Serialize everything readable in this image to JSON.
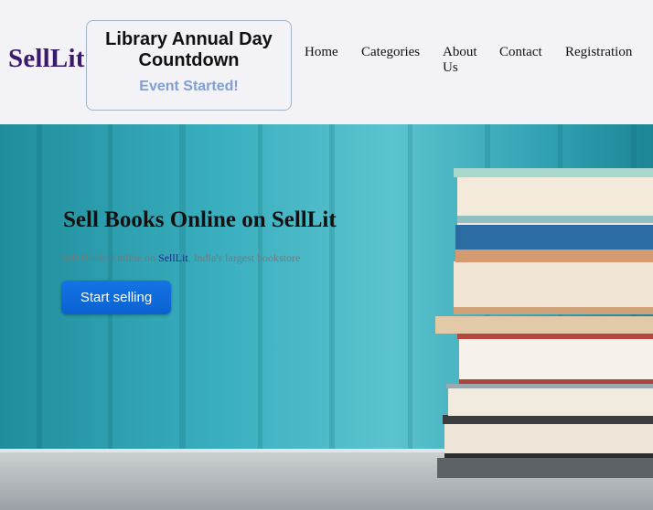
{
  "brand": {
    "logo_text": "SellLit"
  },
  "countdown": {
    "title": "Library Annual Day Countdown",
    "status": "Event Started!"
  },
  "nav": {
    "items": [
      {
        "label": "Home"
      },
      {
        "label": "Categories"
      },
      {
        "label": "About Us"
      },
      {
        "label": "Contact"
      },
      {
        "label": "Registration"
      }
    ]
  },
  "hero": {
    "title": "Sell Books Online on SellLit",
    "subtitle_prefix": "Sell Books Online on ",
    "subtitle_brand": "SellLit",
    "subtitle_suffix": ", India's largest bookstore",
    "cta_label": "Start selling"
  },
  "colors": {
    "logo": "#3a1a6e",
    "status": "#7f9fd6",
    "cta": "#0a62d0",
    "hero_bg": "#2ea6b6"
  }
}
